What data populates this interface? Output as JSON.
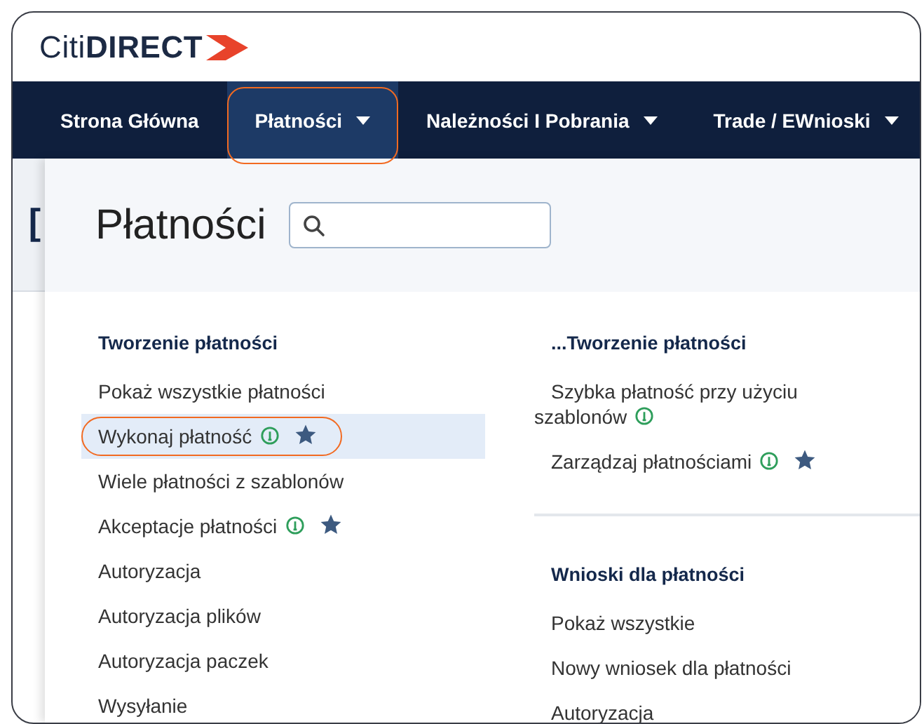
{
  "logo": "Citi**DIRECT**",
  "nav": [
    {
      "label": "Strona Główna",
      "dropdown": false,
      "selected": false,
      "highlighted": false
    },
    {
      "label": "Płatności",
      "dropdown": true,
      "selected": true,
      "highlighted": true
    },
    {
      "label": "Należności I Pobrania",
      "dropdown": true,
      "selected": false,
      "highlighted": false
    },
    {
      "label": "Trade / EWnioski",
      "dropdown": true,
      "selected": false,
      "highlighted": false
    }
  ],
  "background_fragment": "[",
  "panel": {
    "title": "Płatności",
    "columns": [
      {
        "sections": [
          {
            "heading": "Tworzenie płatności",
            "items": [
              {
                "label": "Pokaż wszystkie płatności",
                "info": false,
                "starred": false,
                "selected": false,
                "highlighted": false
              },
              {
                "label": "Wykonaj płatność",
                "info": true,
                "starred": true,
                "selected": true,
                "highlighted": true
              },
              {
                "label": "Wiele płatności z szablonów",
                "info": false,
                "starred": false,
                "selected": false,
                "highlighted": false
              },
              {
                "label": "Akceptacje płatności",
                "info": true,
                "starred": true,
                "selected": false,
                "highlighted": false
              },
              {
                "label": "Autoryzacja",
                "info": false,
                "starred": false,
                "selected": false,
                "highlighted": false
              },
              {
                "label": "Autoryzacja plików",
                "info": false,
                "starred": false,
                "selected": false,
                "highlighted": false
              },
              {
                "label": "Autoryzacja paczek",
                "info": false,
                "starred": false,
                "selected": false,
                "highlighted": false
              },
              {
                "label": "Wysyłanie",
                "info": false,
                "starred": false,
                "selected": false,
                "highlighted": false
              }
            ]
          }
        ]
      },
      {
        "sections": [
          {
            "heading": "...Tworzenie płatności",
            "items": [
              {
                "label": "Szybka płatność przy użyciu szablonów",
                "info": true,
                "starred": false,
                "selected": false,
                "highlighted": false
              },
              {
                "label": "Zarządzaj płatnościami",
                "info": true,
                "starred": true,
                "selected": false,
                "highlighted": false
              }
            ]
          },
          {
            "heading": "Wnioski dla płatności",
            "items": [
              {
                "label": "Pokaż wszystkie",
                "info": false,
                "starred": false,
                "selected": false,
                "highlighted": false
              },
              {
                "label": "Nowy wniosek dla płatności",
                "info": false,
                "starred": false,
                "selected": false,
                "highlighted": false
              },
              {
                "label": "Autoryzacja",
                "info": false,
                "starred": false,
                "selected": false,
                "highlighted": false
              }
            ]
          }
        ]
      }
    ]
  }
}
